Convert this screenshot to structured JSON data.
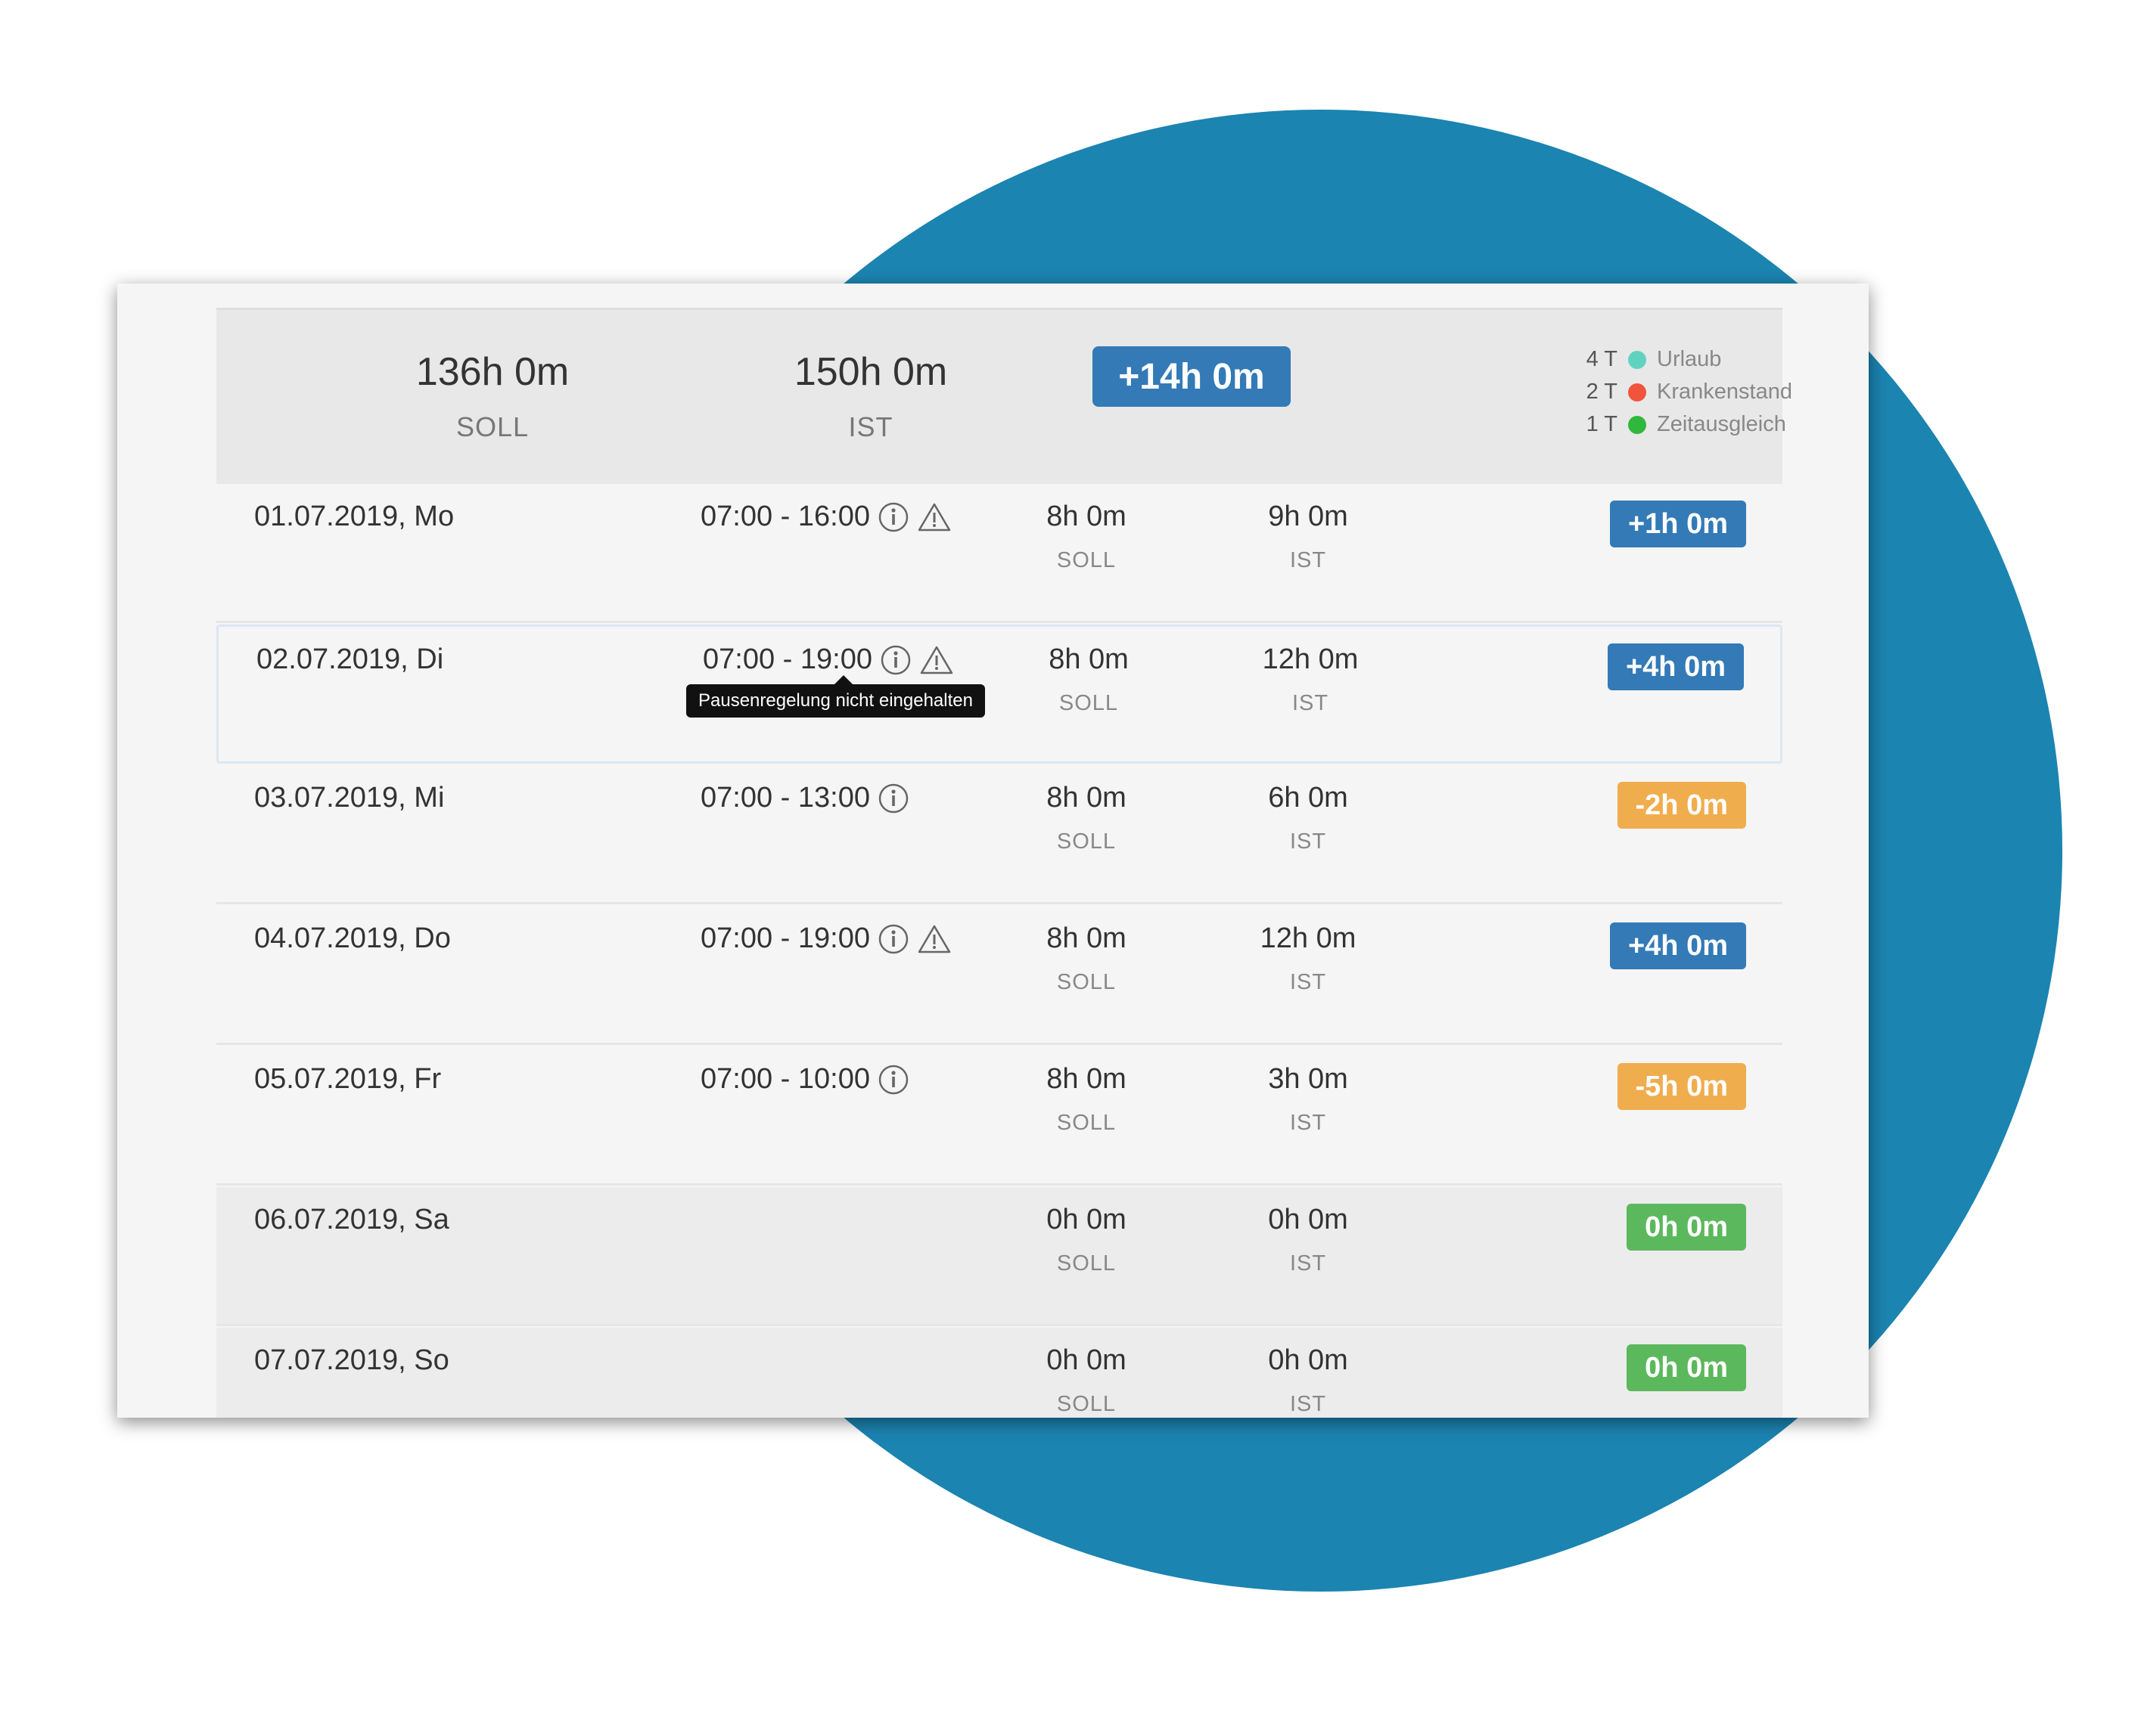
{
  "summary": {
    "soll_value": "136h 0m",
    "soll_label": "SOLL",
    "ist_value": "150h 0m",
    "ist_label": "IST",
    "balance": "+14h 0m",
    "legend": [
      {
        "count": "4 T",
        "label": "Urlaub",
        "color": "#5fd3c0"
      },
      {
        "count": "2 T",
        "label": "Krankenstand",
        "color": "#f0543c"
      },
      {
        "count": "1 T",
        "label": "Zeitausgleich",
        "color": "#2fb83c"
      }
    ]
  },
  "rows": [
    {
      "date": "01.07.2019, Mo",
      "time": "07:00 - 16:00",
      "soll": "8h 0m",
      "soll_label": "SOLL",
      "ist": "9h 0m",
      "ist_label": "IST",
      "diff": "+1h 0m"
    },
    {
      "date": "02.07.2019, Di",
      "time": "07:00 - 19:00",
      "soll": "8h 0m",
      "soll_label": "SOLL",
      "ist": "12h 0m",
      "ist_label": "IST",
      "diff": "+4h 0m"
    },
    {
      "date": "03.07.2019, Mi",
      "time": "07:00 - 13:00",
      "soll": "8h 0m",
      "soll_label": "SOLL",
      "ist": "6h 0m",
      "ist_label": "IST",
      "diff": "-2h 0m"
    },
    {
      "date": "04.07.2019, Do",
      "time": "07:00 - 19:00",
      "soll": "8h 0m",
      "soll_label": "SOLL",
      "ist": "12h 0m",
      "ist_label": "IST",
      "diff": "+4h 0m"
    },
    {
      "date": "05.07.2019, Fr",
      "time": "07:00 - 10:00",
      "soll": "8h 0m",
      "soll_label": "SOLL",
      "ist": "3h 0m",
      "ist_label": "IST",
      "diff": "-5h 0m"
    },
    {
      "date": "06.07.2019, Sa",
      "time": "",
      "soll": "0h 0m",
      "soll_label": "SOLL",
      "ist": "0h 0m",
      "ist_label": "IST",
      "diff": "0h 0m"
    },
    {
      "date": "07.07.2019, So",
      "time": "",
      "soll": "0h 0m",
      "soll_label": "SOLL",
      "ist": "0h 0m",
      "ist_label": "IST",
      "diff": "0h 0m"
    }
  ],
  "tooltip": "Pausenregelung nicht eingehalten",
  "colors": {
    "positive": "#337ab7",
    "negative": "#f0ad4e",
    "neutral": "#5cb85c",
    "background_circle": "#1b84b1"
  }
}
